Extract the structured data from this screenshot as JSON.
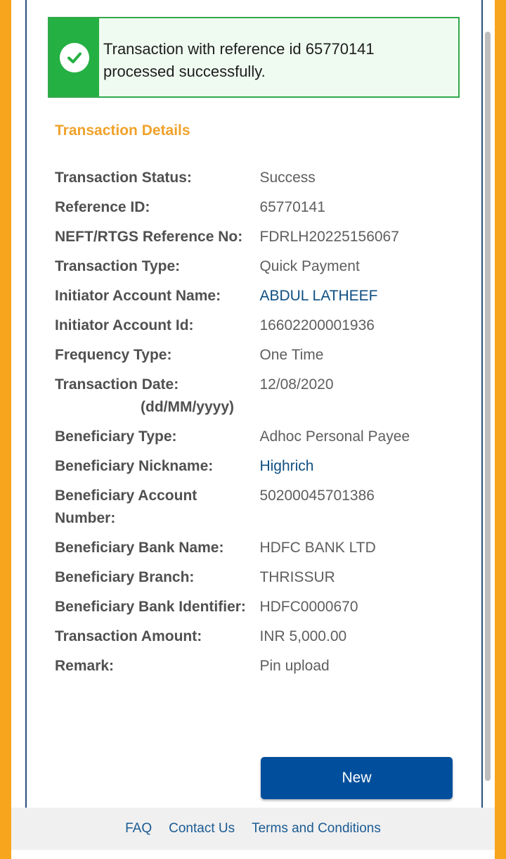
{
  "alert": {
    "message_line1": "Transaction with reference id 65770141",
    "message_line2": "processed successfully.",
    "icon": "check-circle-icon",
    "color": "#25b043"
  },
  "section_title": "Transaction Details",
  "details": [
    {
      "label": "Transaction Status:",
      "value": "Success"
    },
    {
      "label": "Reference ID:",
      "value": "65770141"
    },
    {
      "label": "NEFT/RTGS Reference No:",
      "value": "FDRLH20225156067"
    },
    {
      "label": "Transaction Type:",
      "value": "Quick Payment"
    },
    {
      "label": "Initiator Account Name:",
      "value": "ABDUL LATHEEF",
      "link": true
    },
    {
      "label": "Initiator Account Id:",
      "value": "16602200001936"
    },
    {
      "label": "Frequency Type:",
      "value": "One Time"
    },
    {
      "label": "Transaction Date:",
      "sublabel": "(dd/MM/yyyy)",
      "value": "12/08/2020"
    },
    {
      "label": "Beneficiary Type:",
      "value": "Adhoc Personal Payee"
    },
    {
      "label": "Beneficiary Nickname:",
      "value": "Highrich",
      "link": true
    },
    {
      "label": "Beneficiary Account Number:",
      "value": "50200045701386"
    },
    {
      "label": "Beneficiary Bank Name:",
      "value": "HDFC BANK LTD"
    },
    {
      "label": "Beneficiary Branch:",
      "value": "THRISSUR"
    },
    {
      "label": "Beneficiary Bank Identifier:",
      "value": "HDFC0000670"
    },
    {
      "label": "Transaction Amount:",
      "value": "INR 5,000.00"
    },
    {
      "label": "Remark:",
      "value": "Pin upload"
    }
  ],
  "new_button_label": "New",
  "footer": {
    "faq": "FAQ",
    "contact": "Contact Us",
    "terms": "Terms and Conditions"
  },
  "colors": {
    "background": "#f8a51e",
    "accent_title": "#f0a22a",
    "primary_button": "#014f9c",
    "link": "#0f4f82"
  }
}
